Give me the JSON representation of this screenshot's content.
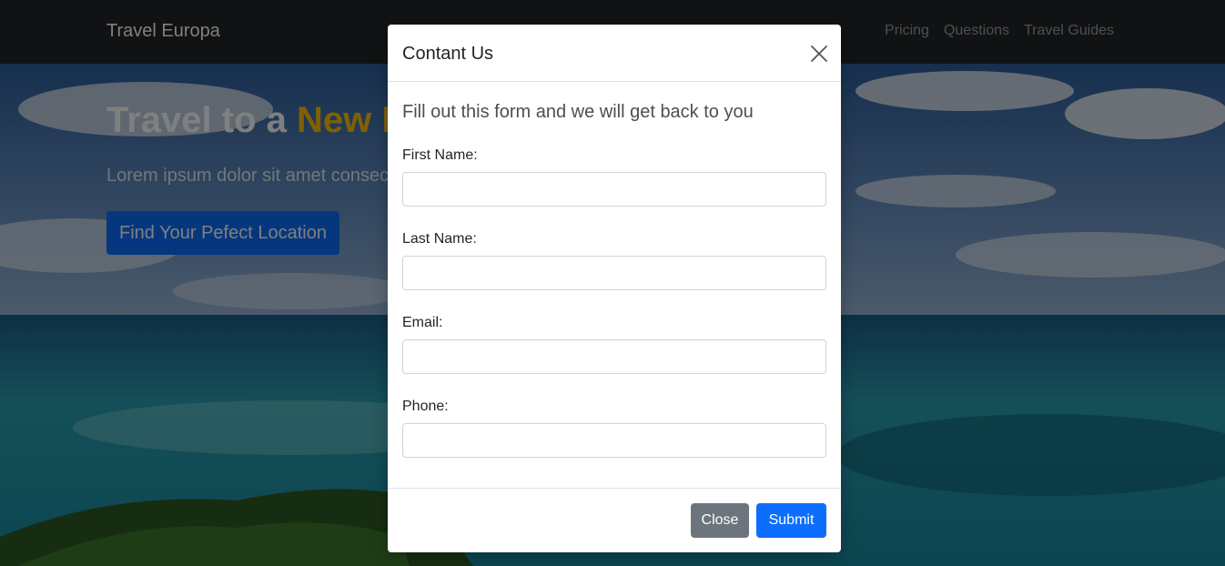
{
  "navbar": {
    "brand": "Travel Europa",
    "links": [
      "Pricing",
      "Questions",
      "Travel Guides"
    ]
  },
  "hero": {
    "title_plain": "Travel to a ",
    "title_accent": "New Location",
    "lead": "Lorem ipsum dolor sit amet consectetur adipisicing elit.",
    "button_label": "Find Your Pefect Location"
  },
  "modal": {
    "title": "Contant Us",
    "close_icon": "close-icon",
    "lead": "Fill out this form and we will get back to you",
    "fields": [
      {
        "label": "First Name:",
        "value": ""
      },
      {
        "label": "Last Name:",
        "value": ""
      },
      {
        "label": "Email:",
        "value": ""
      },
      {
        "label": "Phone:",
        "value": ""
      }
    ],
    "close_label": "Close",
    "submit_label": "Submit"
  },
  "colors": {
    "navbar_bg": "#212529",
    "accent": "#ffc107",
    "primary": "#0d6efd",
    "secondary": "#6c757d"
  }
}
